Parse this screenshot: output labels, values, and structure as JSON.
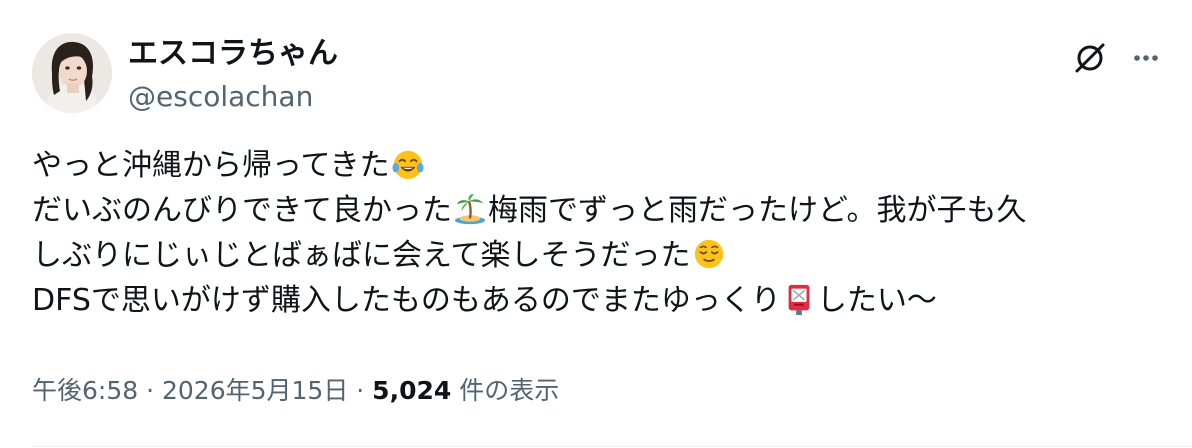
{
  "user": {
    "display_name": "エスコラちゃん",
    "handle": "@escolachan"
  },
  "icons": {
    "grok": "grok-icon",
    "more": "more-horizontal-icon",
    "emoji_1": "face-with-tears-of-joy-emoji",
    "emoji_2": "desert-island-emoji",
    "emoji_3": "relieved-face-emoji",
    "emoji_4": "postbox-emoji"
  },
  "post": {
    "line1": {
      "text": "やっと沖縄から帰ってきた"
    },
    "line2": {
      "text_a": "だいぶのんびりできて良かった",
      "text_b": "梅雨でずっと雨だったけど。我が子も久"
    },
    "line3": {
      "text": "しぶりにじぃじとばぁばに会えて楽しそうだった"
    },
    "line4": {
      "text_a": "DFSで思いがけず購入したものもあるのでまたゆっくり",
      "text_b": "したい〜"
    }
  },
  "meta": {
    "time": "午後6:58",
    "sep1": " · ",
    "date": "2026年5月15日",
    "sep2": " · ",
    "views_count": "5,024",
    "views_label": " 件の表示"
  },
  "colors": {
    "text_primary": "#0f1419",
    "text_secondary": "#536471",
    "divider": "#eff3f4"
  }
}
